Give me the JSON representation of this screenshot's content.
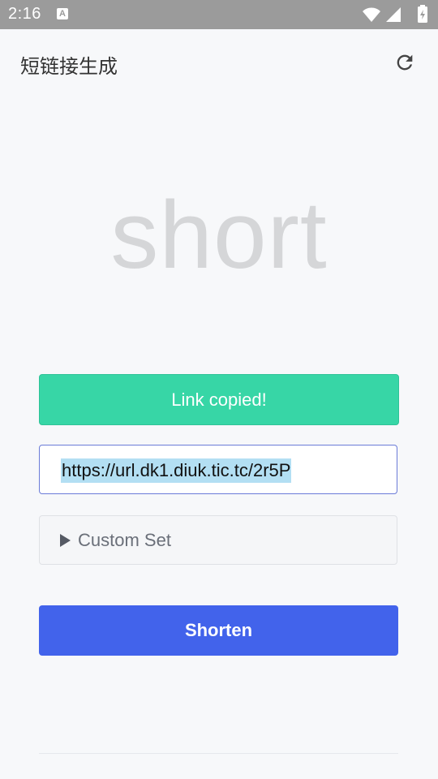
{
  "status_bar": {
    "time": "2:16",
    "notification_icon": "A",
    "icons": [
      "wifi-icon",
      "cell-signal-icon",
      "battery-icon"
    ]
  },
  "app_bar": {
    "title": "短链接生成",
    "refresh_icon": "refresh-icon"
  },
  "hero": {
    "text": "short"
  },
  "toast": {
    "text": "Link copied!",
    "color": "#37d6a6"
  },
  "url_input": {
    "value": "https://url.dk1.diuk.tic.tc/2r5P"
  },
  "custom_set": {
    "label": "Custom Set"
  },
  "shorten": {
    "label": "Shorten",
    "color": "#4263eb"
  }
}
